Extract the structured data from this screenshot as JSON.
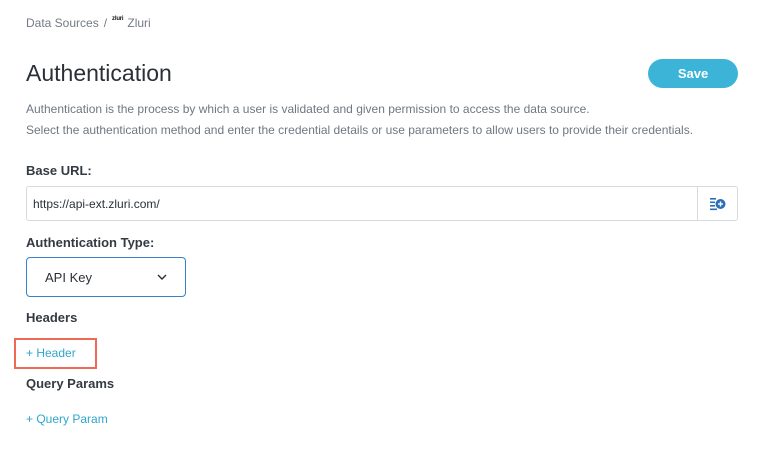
{
  "breadcrumb": {
    "root": "Data Sources",
    "separator": "/",
    "logo_text": "zluri",
    "current": "Zluri"
  },
  "header": {
    "title": "Authentication",
    "save_label": "Save"
  },
  "description": {
    "line1": "Authentication is the process by which a user is validated and given permission to access the data source.",
    "line2": "Select the authentication method and enter the credential details or use parameters to allow users to provide their credentials."
  },
  "base_url": {
    "label": "Base URL:",
    "value": "https://api-ext.zluri.com/"
  },
  "auth_type": {
    "label": "Authentication Type:",
    "selected": "API Key"
  },
  "headers": {
    "label": "Headers",
    "add_label": "+ Header"
  },
  "query_params": {
    "label": "Query Params",
    "add_label": "+ Query Param"
  },
  "colors": {
    "accent": "#3cb4d8",
    "link": "#2fa6cc",
    "highlight": "#ee6a52",
    "select_border": "#3a7fcf"
  }
}
